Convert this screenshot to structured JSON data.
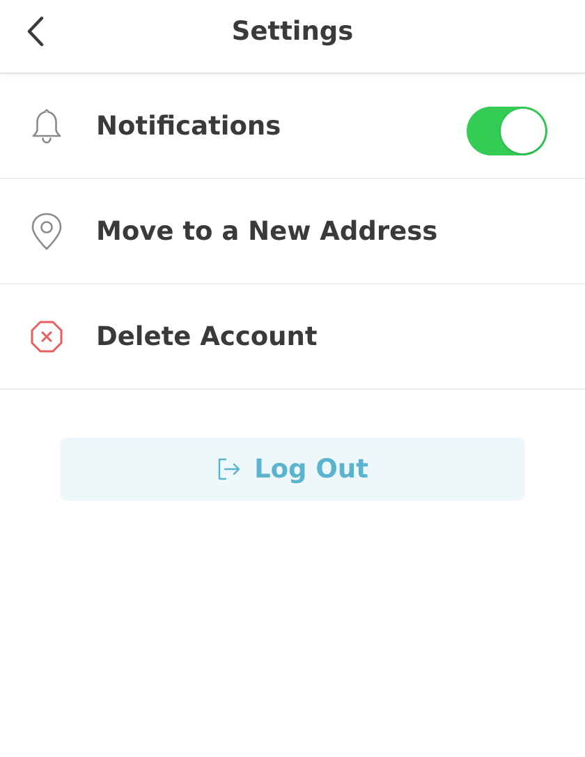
{
  "header": {
    "title": "Settings",
    "back_icon": "chevron-left-icon"
  },
  "settings": {
    "items": [
      {
        "label": "Notifications",
        "icon": "bell-icon",
        "toggle": {
          "on": true,
          "color": "#33cc55"
        }
      },
      {
        "label": "Move to a New Address",
        "icon": "location-pin-icon"
      },
      {
        "label": "Delete Account",
        "icon": "delete-octagon-icon",
        "icon_color": "#e85d5d"
      }
    ]
  },
  "logout": {
    "label": "Log Out",
    "icon": "logout-icon",
    "text_color": "#5bb4cd",
    "background": "#eef7fa"
  }
}
